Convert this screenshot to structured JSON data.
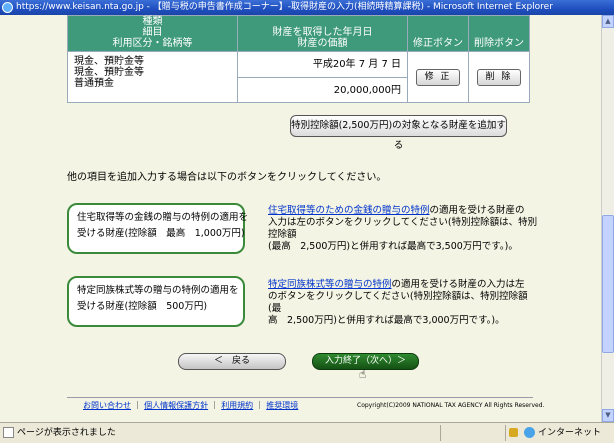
{
  "window": {
    "title": "https://www.keisan.nta.go.jp - 【贈与税の申告書作成コーナー】-取得財産の入力(相続時精算課税) - Microsoft Internet Explorer"
  },
  "table": {
    "headers": {
      "category": [
        "種類",
        "細目",
        "利用区分・銘柄等"
      ],
      "value": [
        "財産を取得した年月日",
        "財産の価額"
      ],
      "edit": "修正ボタン",
      "delete": "削除ボタン"
    },
    "row": {
      "category": [
        "現金、預貯金等",
        "現金、預貯金等",
        "普通預金"
      ],
      "date": "平成20年 7 月 7 日",
      "amount": "20,000,000円",
      "edit_label": "修 正",
      "delete_label": "削 除"
    }
  },
  "special_button": "特別控除額(2,500万円)の対象となる財産を追加する",
  "intro_text": "他の項目を追加入力する場合は以下のボタンをクリックしてください。",
  "housing": {
    "button": [
      "住宅取得等の金銭の贈与の特例の適用を",
      "受ける財産(控除額　最高　1,000万円)"
    ],
    "link": "住宅取得等のための金銭の贈与の特例",
    "desc_lines": [
      "の適用を受ける財産の",
      "入力は左のボタンをクリックしてください(特別控除額は、特別控除額",
      "(最高　2,500万円)と併用すれば最高で3,500万円です。)。"
    ]
  },
  "family": {
    "button": [
      "特定同族株式等の贈与の特例の適用を",
      "受ける財産(控除額　500万円)"
    ],
    "link": "特定同族株式等の贈与の特例",
    "desc_lines": [
      "の適用を受ける財産の入力は左",
      "のボタンをクリックしてください(特別控除額は、特別控除額(最",
      "高　2,500万円)と併用すれば最高で3,000万円です。)。"
    ]
  },
  "nav": {
    "back": "＜　戻る",
    "next": "入力終了（次へ）＞"
  },
  "footer": {
    "links": [
      "お問い合わせ",
      "個人情報保護方針",
      "利用規約",
      "推奨環境"
    ],
    "separator": "｜",
    "copyright": "Copyright(C)2009 NATIONAL TAX AGENCY All Rights Reserved."
  },
  "status": {
    "text": "ページが表示されました",
    "zone": "インターネット"
  }
}
